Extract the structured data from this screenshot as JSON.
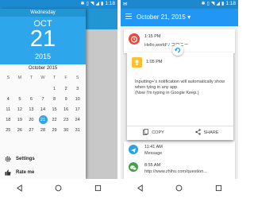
{
  "left": {
    "status": {
      "time": "1:18"
    },
    "header": {
      "weekday": "Wednesday",
      "month": "OCT",
      "date": "21",
      "year": "2015"
    },
    "calendar": {
      "title": "October 2015",
      "weekdays": [
        "S",
        "M",
        "T",
        "W",
        "T",
        "F",
        "S"
      ],
      "weeks": [
        [
          "",
          "",
          "",
          "",
          "1",
          "2",
          "3"
        ],
        [
          "4",
          "5",
          "6",
          "7",
          "8",
          "9",
          "10"
        ],
        [
          "11",
          "12",
          "13",
          "14",
          "15",
          "16",
          "17"
        ],
        [
          "18",
          "19",
          "20",
          "21",
          "22",
          "23",
          "24"
        ],
        [
          "25",
          "26",
          "27",
          "28",
          "29",
          "30",
          "31"
        ]
      ],
      "selected": "21"
    },
    "menu": {
      "settings": "Settings",
      "rate": "Rate me"
    }
  },
  "right": {
    "status": {
      "time": "1:18"
    },
    "appbar": {
      "title": "October 21, 2015"
    },
    "notif1": {
      "time": "1:15 PM",
      "text": "Hello,world! / コロニー"
    },
    "popup": {
      "time": "1:05 PM",
      "message": "Inputting+'s notification will automatically show when tying in any app.",
      "submessage": "(Now I'm typing in Google Keep.)",
      "copy": "COPY",
      "share": "SHARE"
    },
    "notif2": {
      "time": "11:41 AM",
      "text": "Message"
    },
    "notif3": {
      "time": "8:55 AM",
      "text": "http://www.zhihu.com/question..."
    }
  },
  "colors": {
    "primary": "#2196f3",
    "header": "#2ea6eb",
    "accent": "#f44336"
  }
}
